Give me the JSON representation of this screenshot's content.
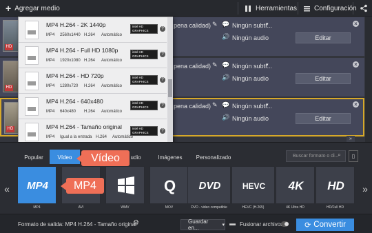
{
  "toolbar": {
    "add_media": "Agregar medio",
    "tools": "Herramientas",
    "settings": "Configuración"
  },
  "files": [
    {
      "partial_quality": "pena calidad)",
      "subtitles": "Ningún subtí...",
      "audio": "Ningún audio",
      "edit": "Editar"
    },
    {
      "partial_quality": "pena calidad)",
      "subtitles": "Ningún subtí...",
      "audio": "Ningún audio",
      "edit": "Editar"
    },
    {
      "partial_quality": "pena calidad)",
      "subtitles": "Ningún subtí...",
      "audio": "Ningún audio",
      "edit": "Editar"
    }
  ],
  "presets": [
    {
      "title": "MP4 H.264 - 2K 1440p",
      "specs": [
        "MP4",
        "2560x1440",
        "H.264",
        "Automático"
      ]
    },
    {
      "title": "MP4 H.264 - Full HD 1080p",
      "specs": [
        "MP4",
        "1920x1080",
        "H.264",
        "Automático"
      ]
    },
    {
      "title": "MP4 H.264 - HD 720p",
      "specs": [
        "MP4",
        "1280x720",
        "H.264",
        "Automático"
      ]
    },
    {
      "title": "MP4 H.264 - 640x480",
      "specs": [
        "MP4",
        "640x480",
        "H.264",
        "Automático"
      ]
    },
    {
      "title": "MP4 H.264 - Tamaño original",
      "specs": [
        "MP4",
        "Igual a la entrada",
        "H.264",
        "Automático"
      ]
    }
  ],
  "intel_badge": "intel HD GRAPHICS",
  "tabs": [
    "Popular",
    "Vídeo",
    "Audio",
    "Imágenes",
    "Personalizado"
  ],
  "tab_visible_fragment": "udio",
  "search_placeholder": "Buscar formato o di...",
  "formats": [
    {
      "logo": "MP4",
      "label": "MP4"
    },
    {
      "logo": "AVI",
      "label": "AVI"
    },
    {
      "logo": "WMV",
      "label": "WMV"
    },
    {
      "logo": "Q",
      "label": "MOV"
    },
    {
      "logo": "DVD",
      "label": "DVD - video compatible"
    },
    {
      "logo": "HEVC",
      "label": "HEVC (H.265)"
    },
    {
      "logo": "4K",
      "label": "4K Ultra HD"
    },
    {
      "logo": "HD",
      "label": "HD/Full HD"
    }
  ],
  "callouts": {
    "video": "Vídeo",
    "mp4": "MP4"
  },
  "bottom": {
    "output_format": "Formato de salida: MP4 H.264 - Tamaño original",
    "save_in": "Guardar en...",
    "merge_files": "Fusionar archivos",
    "convert": "Convertir"
  },
  "colors": {
    "accent": "#3a8de0",
    "callout": "#ef6f57",
    "selected_border": "#d7a92a"
  }
}
